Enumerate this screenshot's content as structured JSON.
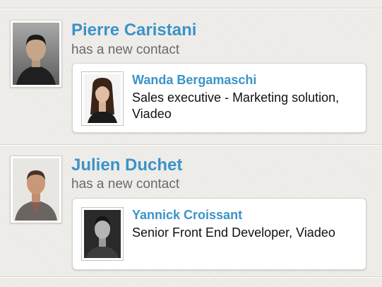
{
  "feed": {
    "items": [
      {
        "actor_name": "Pierre Caristani",
        "action": "has a new contact",
        "contact": {
          "name": "Wanda Bergamaschi",
          "title": "Sales executive - Marketing solution, Viadeo"
        }
      },
      {
        "actor_name": "Julien Duchet",
        "action": "has a new contact",
        "contact": {
          "name": "Yannick Croissant",
          "title": "Senior Front End Developer, Viadeo"
        }
      }
    ]
  },
  "colors": {
    "accent": "#3b93c8",
    "background": "#efedea",
    "card": "#ffffff"
  },
  "icons": {
    "actor_avatar": "person-photo",
    "contact_avatar": "person-photo"
  }
}
